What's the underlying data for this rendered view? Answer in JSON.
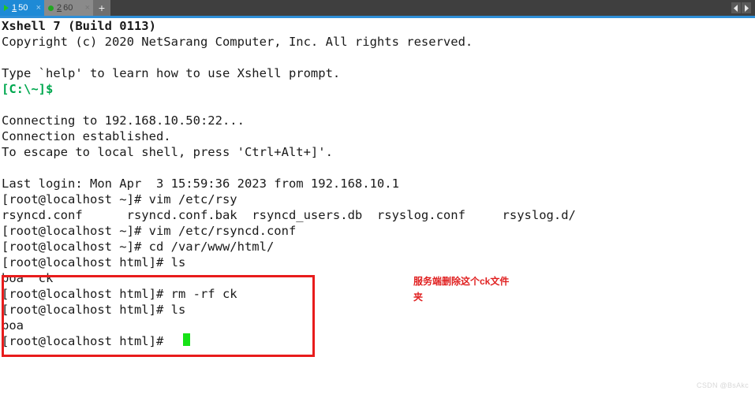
{
  "window": {
    "tab_strip": {
      "tabs": [
        {
          "number": "1",
          "name": "50",
          "status_icon": "play-triangle-icon",
          "close_glyph": "×",
          "active": true
        },
        {
          "number": "2",
          "name": "60",
          "status_icon": "green-dot-icon",
          "close_glyph": "×",
          "active": false
        }
      ],
      "new_tab_label": "+",
      "nav_prev_icon": "chevron-left-icon",
      "nav_next_icon": "chevron-right-icon",
      "active_tab_color": "#1e8ad6",
      "inactive_tab_color": "#8a8a8a",
      "strip_background": "#3f3f3f",
      "underline_color": "#2f8fd8"
    }
  },
  "terminal": {
    "background": "#ffffff",
    "foreground": "#1a1a1a",
    "prompt_color": "#00a84f",
    "cursor_color": "#17e217",
    "lines": [
      {
        "text": "Xshell 7 (Build 0113)",
        "style": "bold"
      },
      {
        "text": "Copyright (c) 2020 NetSarang Computer, Inc. All rights reserved.",
        "style": "normal"
      },
      {
        "text": "",
        "style": "normal"
      },
      {
        "text": "Type `help' to learn how to use Xshell prompt.",
        "style": "normal"
      },
      {
        "text": "[C:\\~]$",
        "style": "green"
      },
      {
        "text": "",
        "style": "normal"
      },
      {
        "text": "Connecting to 192.168.10.50:22...",
        "style": "normal"
      },
      {
        "text": "Connection established.",
        "style": "normal"
      },
      {
        "text": "To escape to local shell, press 'Ctrl+Alt+]'.",
        "style": "normal"
      },
      {
        "text": "",
        "style": "normal"
      },
      {
        "text": "Last login: Mon Apr  3 15:59:36 2023 from 192.168.10.1",
        "style": "normal"
      },
      {
        "text": "[root@localhost ~]# vim /etc/rsy",
        "style": "normal"
      },
      {
        "text": "rsyncd.conf      rsyncd.conf.bak  rsyncd_users.db  rsyslog.conf     rsyslog.d/",
        "style": "normal"
      },
      {
        "text": "[root@localhost ~]# vim /etc/rsyncd.conf",
        "style": "normal"
      },
      {
        "text": "[root@localhost ~]# cd /var/www/html/",
        "style": "normal"
      },
      {
        "text": "[root@localhost html]# ls",
        "style": "normal"
      },
      {
        "text": "boa  ck",
        "style": "normal"
      },
      {
        "text": "[root@localhost html]# rm -rf ck",
        "style": "normal"
      },
      {
        "text": "[root@localhost html]# ls",
        "style": "normal"
      },
      {
        "text": "boa",
        "style": "normal"
      },
      {
        "text": "[root@localhost html]#",
        "style": "normal"
      }
    ]
  },
  "annotations": {
    "highlight_box_color": "#e81c1c",
    "note_text": "服务端删除这个ck文件夹",
    "note_color": "#e02020"
  },
  "watermark": {
    "text": "CSDN @BsAkc"
  }
}
